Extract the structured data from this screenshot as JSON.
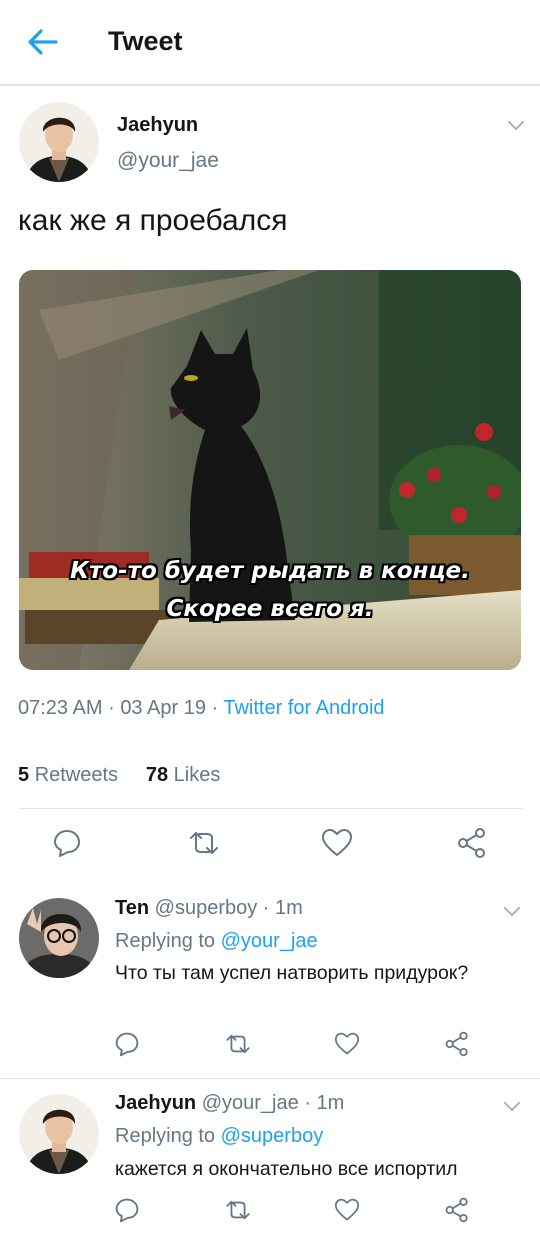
{
  "header": {
    "title": "Tweet"
  },
  "tweet": {
    "author_name": "Jaehyun",
    "author_handle": "@your_jae",
    "text": "как же я проебался",
    "media_caption_line1": "Кто-то будет рыдать в конце.",
    "media_caption_line2": "Скорее всего я.",
    "time": "07:23 AM",
    "date": "03 Apr 19",
    "source": "Twitter for Android",
    "retweets_count": "5",
    "retweets_label": "Retweets",
    "likes_count": "78",
    "likes_label": "Likes"
  },
  "replies": [
    {
      "name": "Ten",
      "handle": "@superboy",
      "time": "1m",
      "replying_label": "Replying to",
      "replying_to": "@your_jae",
      "text": "Что ты там успел натворить придурок?"
    },
    {
      "name": "Jaehyun",
      "handle": "@your_jae",
      "time": "1m",
      "replying_label": "Replying to",
      "replying_to": "@superboy",
      "text": "кажется я окончательно все испортил"
    }
  ],
  "colors": {
    "accent": "#1da1f2",
    "secondary_text": "#657786",
    "icon": "#657786"
  }
}
